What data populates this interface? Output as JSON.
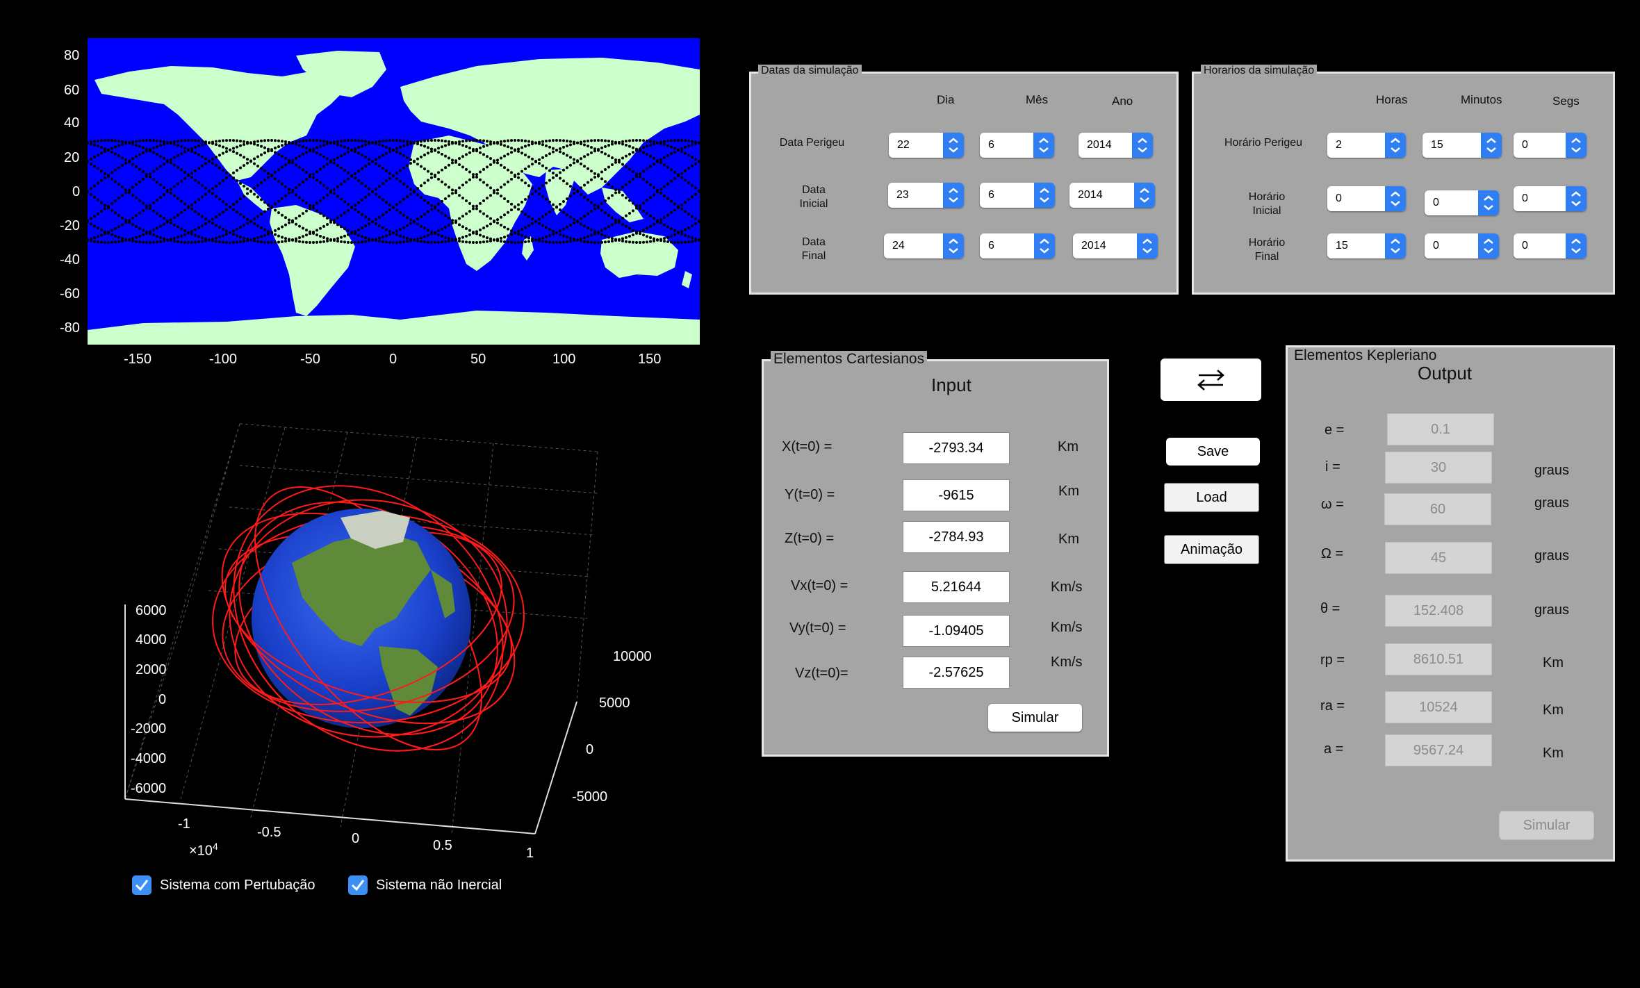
{
  "map": {
    "ytick_labels": [
      "80",
      "60",
      "40",
      "20",
      "0",
      "-20",
      "-40",
      "-60",
      "-80"
    ],
    "xtick_labels": [
      "-150",
      "-100",
      "-50",
      "0",
      "50",
      "100",
      "150"
    ],
    "colors": {
      "ocean": "#0000ff",
      "land": "#ccffcc",
      "track": "#000000"
    }
  },
  "orbit3d": {
    "z_tick_labels": [
      "6000",
      "4000",
      "2000",
      "0",
      "-2000",
      "-4000",
      "-6000"
    ],
    "y_tick_labels": [
      "10000",
      "5000",
      "0",
      "-5000"
    ],
    "x_tick_labels": [
      "-1",
      "-0.5",
      "0",
      "0.5",
      "1"
    ],
    "x_exponent_base": "×10",
    "x_exponent_power": "4",
    "colors": {
      "orbit": "#ff0000",
      "earth": "#1a3fc9"
    }
  },
  "checkboxes": {
    "perturbation": {
      "label": "Sistema com Pertubação",
      "checked": true
    },
    "non_inertial": {
      "label": "Sistema não Inercial",
      "checked": true
    }
  },
  "dates": {
    "title": "Datas da simulação",
    "headers": {
      "day": "Dia",
      "month": "Mês",
      "year": "Ano"
    },
    "perigee": {
      "label": "Data Perigeu",
      "day": "22",
      "month": "6",
      "year": "2014"
    },
    "initial": {
      "label1": "Data",
      "label2": "Inicial",
      "day": "23",
      "month": "6",
      "year": "2014"
    },
    "final": {
      "label1": "Data",
      "label2": "Final",
      "day": "24",
      "month": "6",
      "year": "2014"
    }
  },
  "times": {
    "title": "Horarios da simulação",
    "headers": {
      "hours": "Horas",
      "minutes": "Minutos",
      "seconds": "Segs"
    },
    "perigee": {
      "label": "Horário Perigeu",
      "h": "2",
      "m": "15",
      "s": "0"
    },
    "initial": {
      "label1": "Horário",
      "label2": "Inicial",
      "h": "0",
      "m": "0",
      "s": "0"
    },
    "final": {
      "label1": "Horário",
      "label2": "Final",
      "h": "15",
      "m": "0",
      "s": "0"
    }
  },
  "cartesian": {
    "title": "Elementos Cartesianos",
    "subtitle": "Input",
    "rows": [
      {
        "label": "X(t=0) =",
        "value": "-2793.34",
        "unit": "Km"
      },
      {
        "label": "Y(t=0) =",
        "value": "-9615",
        "unit": "Km"
      },
      {
        "label": "Z(t=0) =",
        "value": "-2784.93",
        "unit": "Km"
      },
      {
        "label": "Vx(t=0) =",
        "value": "5.21644",
        "unit": "Km/s"
      },
      {
        "label": "Vy(t=0) =",
        "value": "-1.09405",
        "unit": "Km/s"
      },
      {
        "label": "Vz(t=0)=",
        "value": "-2.57625",
        "unit": "Km/s"
      }
    ],
    "simulate": "Simular"
  },
  "actions": {
    "swap_icon": "swap-arrows-icon",
    "save": "Save",
    "load": "Load",
    "animate": "Animação"
  },
  "keplerian": {
    "title": "Elementos Kepleriano",
    "subtitle": "Output",
    "rows": [
      {
        "label": "e =",
        "value": "0.1",
        "unit": ""
      },
      {
        "label": "i =",
        "value": "30",
        "unit": "graus"
      },
      {
        "label": "ω =",
        "value": "60",
        "unit": "graus"
      },
      {
        "label": "Ω =",
        "value": "45",
        "unit": "graus"
      },
      {
        "label": "θ =",
        "value": "152.408",
        "unit": "graus"
      },
      {
        "label": "rp =",
        "value": "8610.51",
        "unit": "Km"
      },
      {
        "label": "ra =",
        "value": "10524",
        "unit": "Km"
      },
      {
        "label": "a =",
        "value": "9567.24",
        "unit": "Km"
      }
    ],
    "simulate": "Simular"
  }
}
